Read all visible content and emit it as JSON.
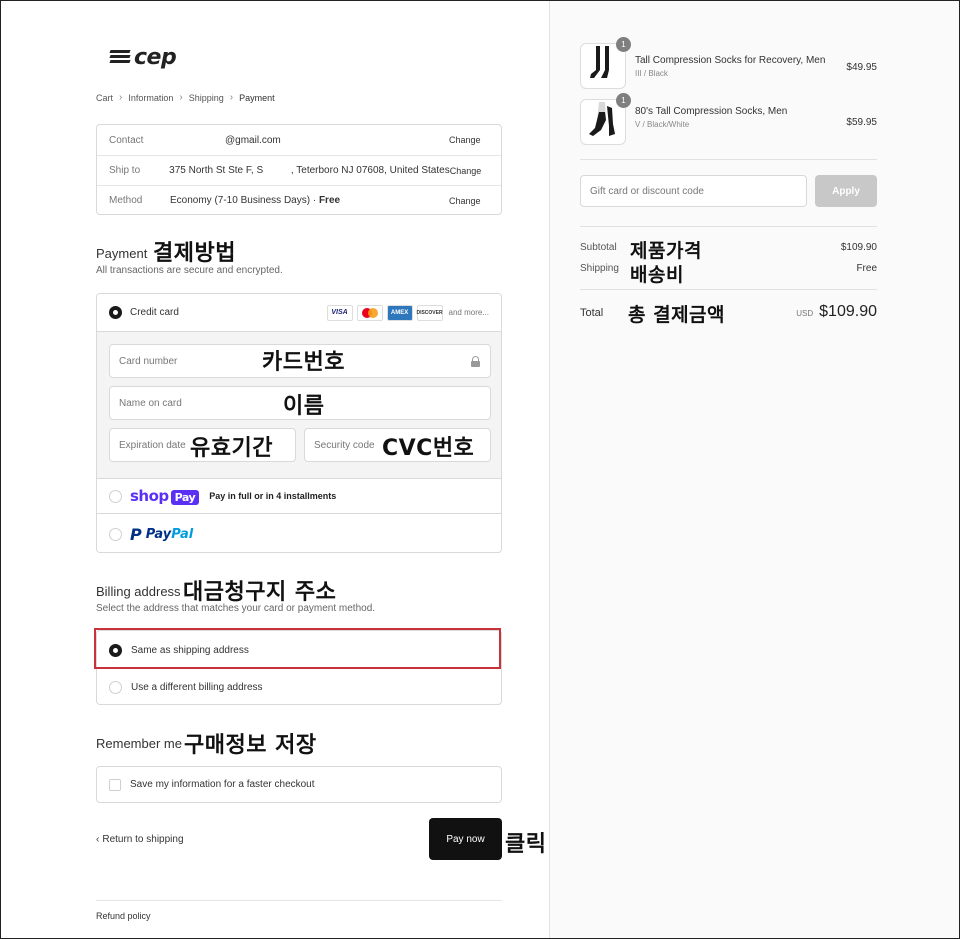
{
  "brand": {
    "logo_text": "cep"
  },
  "breadcrumbs": [
    "Cart",
    "Information",
    "Shipping",
    "Payment"
  ],
  "summary": {
    "contact_label": "Contact",
    "contact_value": "@gmail.com",
    "ship_label": "Ship to",
    "ship_value": "375 North St Ste F, S          , Teterboro NJ 07608, United States",
    "method_label": "Method",
    "method_value": "Economy (7-10 Business Days) · ",
    "method_price": "Free",
    "change": "Change"
  },
  "payment": {
    "title": "Payment",
    "annotation": "결제방법",
    "subtitle": "All transactions are secure and encrypted.",
    "credit_card_label": "Credit card",
    "card_brands": [
      "VISA",
      "AMEX",
      "DISCOVER"
    ],
    "and_more": "and more...",
    "card_number_placeholder": "Card number",
    "card_number_annotation": "카드번호",
    "name_placeholder": "Name on card",
    "name_annotation": "이름",
    "expiry_placeholder": "Expiration date",
    "expiry_annotation": "유효기간",
    "security_placeholder": "Security code",
    "security_annotation": "CVC번호",
    "shop_logo": "shop",
    "shop_pay_badge": "Pay",
    "shop_text": "Pay in full or in 4 installments",
    "paypal_a": "Pay",
    "paypal_b": "Pal"
  },
  "billing": {
    "title": "Billing address",
    "annotation": "대금청구지 주소",
    "subtitle": "Select the address that matches your card or payment method.",
    "same_label": "Same as shipping address",
    "different_label": "Use a different billing address"
  },
  "remember": {
    "title": "Remember me",
    "annotation": "구매정보 저장",
    "save_label": "Save my information for a faster checkout"
  },
  "actions": {
    "return_label": "Return to shipping",
    "pay_now": "Pay now",
    "pay_annotation": "클릭",
    "refund_policy": "Refund policy"
  },
  "order": {
    "items": [
      {
        "qty": "1",
        "name": "Tall Compression Socks for Recovery, Men",
        "variant": "III / Black",
        "price": "$49.95"
      },
      {
        "qty": "1",
        "name": "80's Tall Compression Socks, Men",
        "variant": "V / Black/White",
        "price": "$59.95"
      }
    ],
    "discount_placeholder": "Gift card or discount code",
    "apply_label": "Apply",
    "subtotal_label": "Subtotal",
    "subtotal_annotation": "제품가격",
    "subtotal_value": "$109.90",
    "shipping_label": "Shipping",
    "shipping_annotation": "배송비",
    "shipping_value": "Free",
    "total_label": "Total",
    "total_annotation": "총 결제금액",
    "currency": "USD",
    "total_value": "$109.90"
  },
  "colors": {
    "accent": "#1a1a1a",
    "highlight": "#c8323a",
    "shop_pay": "#5a31f4"
  }
}
